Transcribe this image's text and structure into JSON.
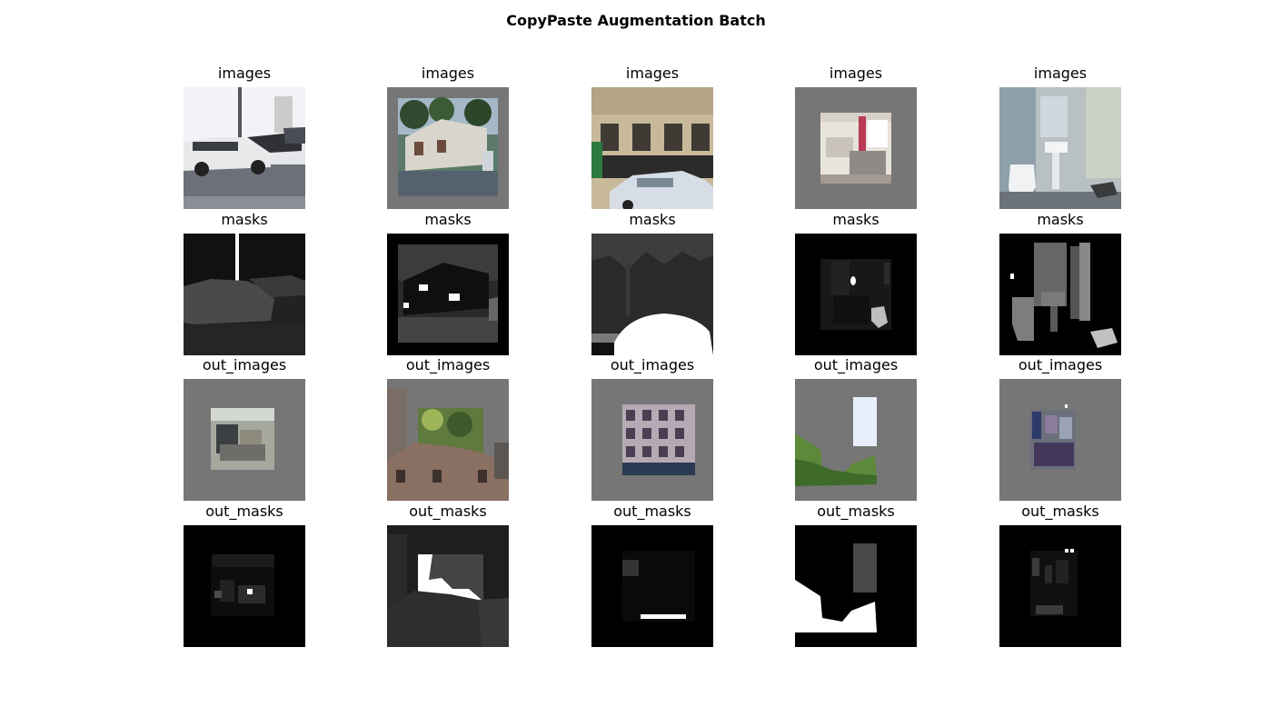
{
  "figure": {
    "title": "CopyPaste Augmentation Batch"
  },
  "rows": [
    {
      "label": "images",
      "panels": [
        {
          "label": "images",
          "content": "street-scene-with-white-sedan"
        },
        {
          "label": "images",
          "content": "house-with-trees-on-gray-padding"
        },
        {
          "label": "images",
          "content": "building-facade-with-parked-car"
        },
        {
          "label": "images",
          "content": "kitchen-interior-on-gray-padding"
        },
        {
          "label": "images",
          "content": "bathroom-interior"
        }
      ]
    },
    {
      "label": "masks",
      "panels": [
        {
          "label": "masks",
          "content": "car-segmentation-mask"
        },
        {
          "label": "masks",
          "content": "house-segmentation-mask"
        },
        {
          "label": "masks",
          "content": "street-segmentation-mask"
        },
        {
          "label": "masks",
          "content": "kitchen-segmentation-mask"
        },
        {
          "label": "masks",
          "content": "bathroom-segmentation-mask"
        }
      ]
    },
    {
      "label": "out_images",
      "panels": [
        {
          "label": "out_images",
          "content": "pasted-office-interior"
        },
        {
          "label": "out_images",
          "content": "pasted-old-town-and-foliage"
        },
        {
          "label": "out_images",
          "content": "pasted-apartment-facade"
        },
        {
          "label": "out_images",
          "content": "pasted-grass-and-window"
        },
        {
          "label": "out_images",
          "content": "pasted-cluttered-room"
        }
      ]
    },
    {
      "label": "out_masks",
      "panels": [
        {
          "label": "out_masks",
          "content": "office-output-mask"
        },
        {
          "label": "out_masks",
          "content": "old-town-output-mask"
        },
        {
          "label": "out_masks",
          "content": "facade-output-mask"
        },
        {
          "label": "out_masks",
          "content": "grass-window-output-mask"
        },
        {
          "label": "out_masks",
          "content": "room-output-mask"
        }
      ]
    }
  ]
}
